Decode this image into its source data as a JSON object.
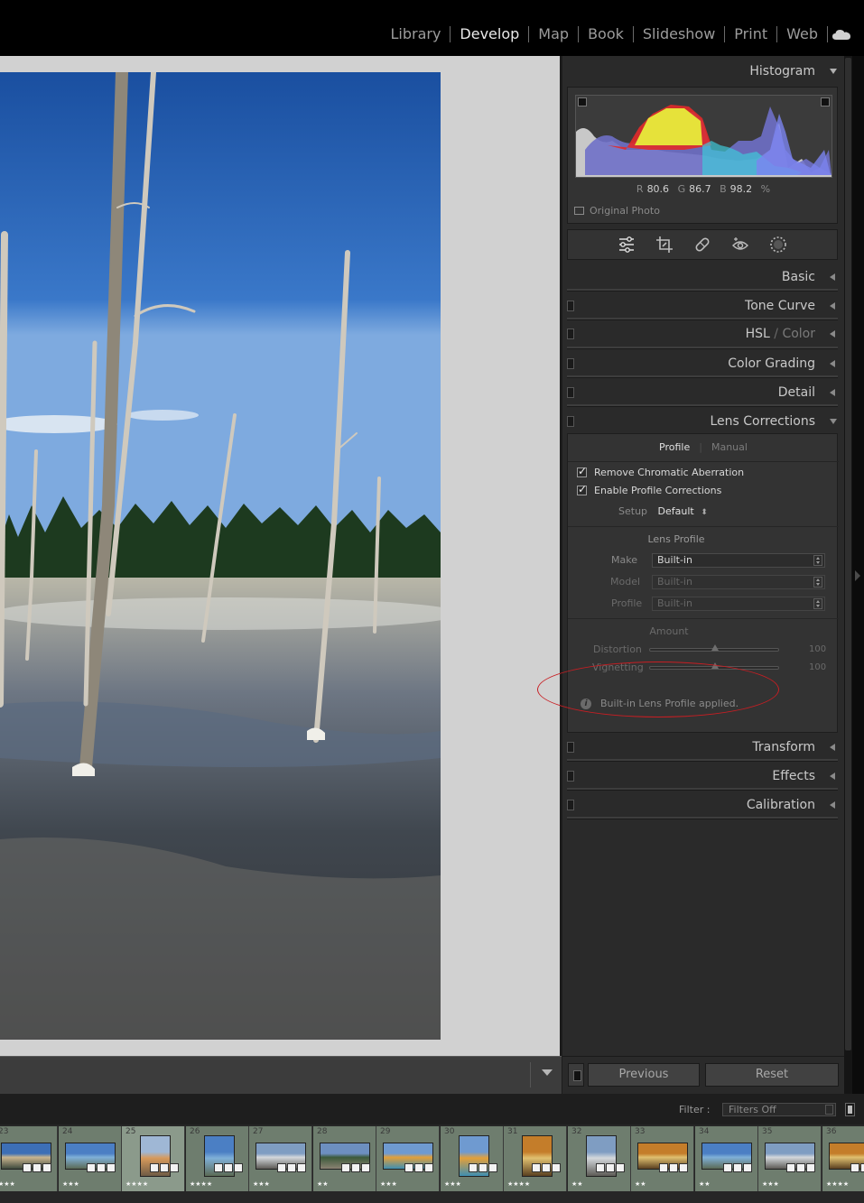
{
  "modules": [
    "Library",
    "Develop",
    "Map",
    "Book",
    "Slideshow",
    "Print",
    "Web"
  ],
  "active_module": "Develop",
  "histogram": {
    "title": "Histogram",
    "readout": {
      "r_label": "R",
      "r": "80.6",
      "g_label": "G",
      "g": "86.7",
      "b_label": "B",
      "b": "98.2",
      "unit": "%"
    },
    "original_photo": "Original Photo"
  },
  "panels": {
    "basic": "Basic",
    "tone_curve": "Tone Curve",
    "hsl": "HSL",
    "hsl_slash": "/",
    "color": "Color",
    "color_grading": "Color Grading",
    "detail": "Detail",
    "lens_corrections": "Lens Corrections",
    "transform": "Transform",
    "effects": "Effects",
    "calibration": "Calibration"
  },
  "lens": {
    "tab_profile": "Profile",
    "tab_separator": "|",
    "tab_manual": "Manual",
    "remove_ca": "Remove Chromatic Aberration",
    "enable_profile": "Enable Profile Corrections",
    "setup_label": "Setup",
    "setup_value": "Default",
    "lens_profile_heading": "Lens Profile",
    "make_label": "Make",
    "make_value": "Built-in",
    "model_label": "Model",
    "model_value": "Built-in",
    "profile_label": "Profile",
    "profile_value": "Built-in",
    "amount_heading": "Amount",
    "distortion_label": "Distortion",
    "distortion_value": "100",
    "vignetting_label": "Vignetting",
    "vignetting_value": "100",
    "info_message": "Built-in Lens Profile applied."
  },
  "buttons": {
    "previous": "Previous",
    "reset": "Reset"
  },
  "filter": {
    "label": "Filter :",
    "value": "Filters Off"
  },
  "filmstrip": [
    {
      "num": "23",
      "stars": "★★★",
      "orient": "wide",
      "palette": "yellowstone"
    },
    {
      "num": "24",
      "stars": "★★★",
      "orient": "wide",
      "palette": "pool"
    },
    {
      "num": "25",
      "stars": "★★★★",
      "orient": "tall",
      "palette": "spring",
      "stack": "2"
    },
    {
      "num": "26",
      "stars": "★★★★",
      "orient": "tall",
      "palette": "pool"
    },
    {
      "num": "27",
      "stars": "★★★",
      "orient": "wide",
      "palette": "steam"
    },
    {
      "num": "28",
      "stars": "★★",
      "orient": "wide",
      "palette": "forest"
    },
    {
      "num": "29",
      "stars": "★★★",
      "orient": "wide",
      "palette": "prismatic"
    },
    {
      "num": "30",
      "stars": "★★★",
      "orient": "tall",
      "palette": "prismatic"
    },
    {
      "num": "31",
      "stars": "★★★★",
      "orient": "tall",
      "palette": "canyon"
    },
    {
      "num": "32",
      "stars": "★★",
      "orient": "tall",
      "palette": "steam"
    },
    {
      "num": "33",
      "stars": "★★",
      "orient": "wide",
      "palette": "canyon"
    },
    {
      "num": "34",
      "stars": "★★",
      "orient": "wide",
      "palette": "pool"
    },
    {
      "num": "35",
      "stars": "★★★",
      "orient": "wide",
      "palette": "steam"
    },
    {
      "num": "36",
      "stars": "★★★★",
      "orient": "wide",
      "palette": "canyon"
    }
  ],
  "colors": {
    "accent_ring": "#c81e23",
    "panel_bg": "#2a2a2a",
    "canvas_bg": "#d1d1d1"
  }
}
